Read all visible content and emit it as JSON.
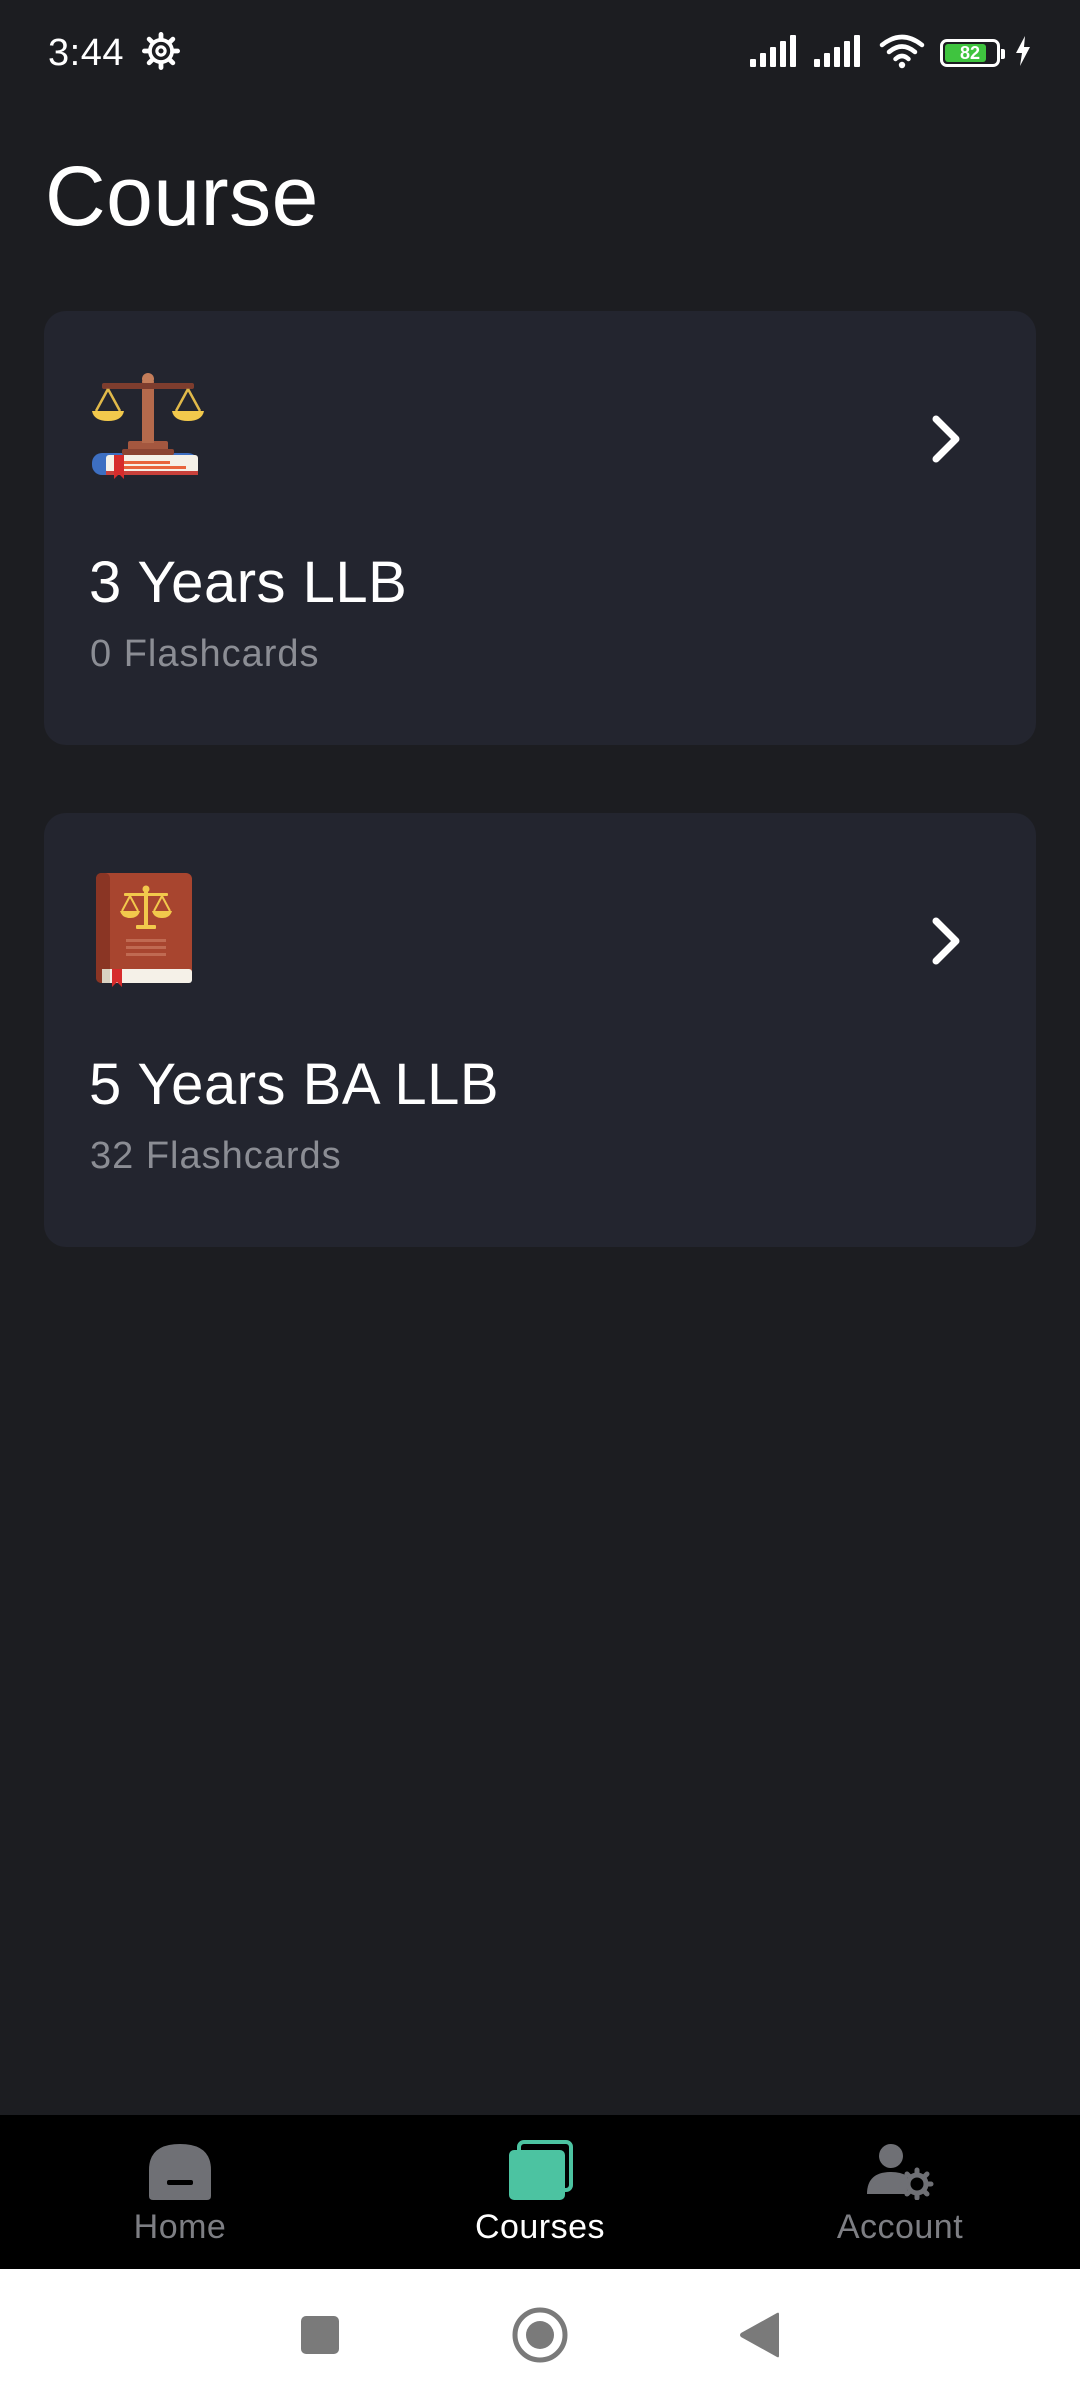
{
  "status_bar": {
    "time": "3:44",
    "battery_level": "82",
    "icons": [
      "settings-gear-icon",
      "signal-icon",
      "signal-icon",
      "wifi-icon",
      "battery-icon",
      "charging-bolt-icon"
    ]
  },
  "page": {
    "title": "Course"
  },
  "courses": [
    {
      "title": "3 Years LLB",
      "subtitle": "0 Flashcards",
      "icon": "scales-of-justice-on-book-icon"
    },
    {
      "title": "5 Years BA LLB",
      "subtitle": "32 Flashcards",
      "icon": "law-book-icon"
    }
  ],
  "bottom_nav": {
    "items": [
      {
        "label": "Home",
        "icon": "home-icon",
        "active": false
      },
      {
        "label": "Courses",
        "icon": "courses-icon",
        "active": true
      },
      {
        "label": "Account",
        "icon": "account-settings-icon",
        "active": false
      }
    ]
  },
  "colors": {
    "background": "#1c1d21",
    "card": "#23252f",
    "accent": "#4cc3a1",
    "muted_text": "#8b8d94",
    "inactive_nav": "#7d7e83",
    "battery": "#3fc43f"
  }
}
